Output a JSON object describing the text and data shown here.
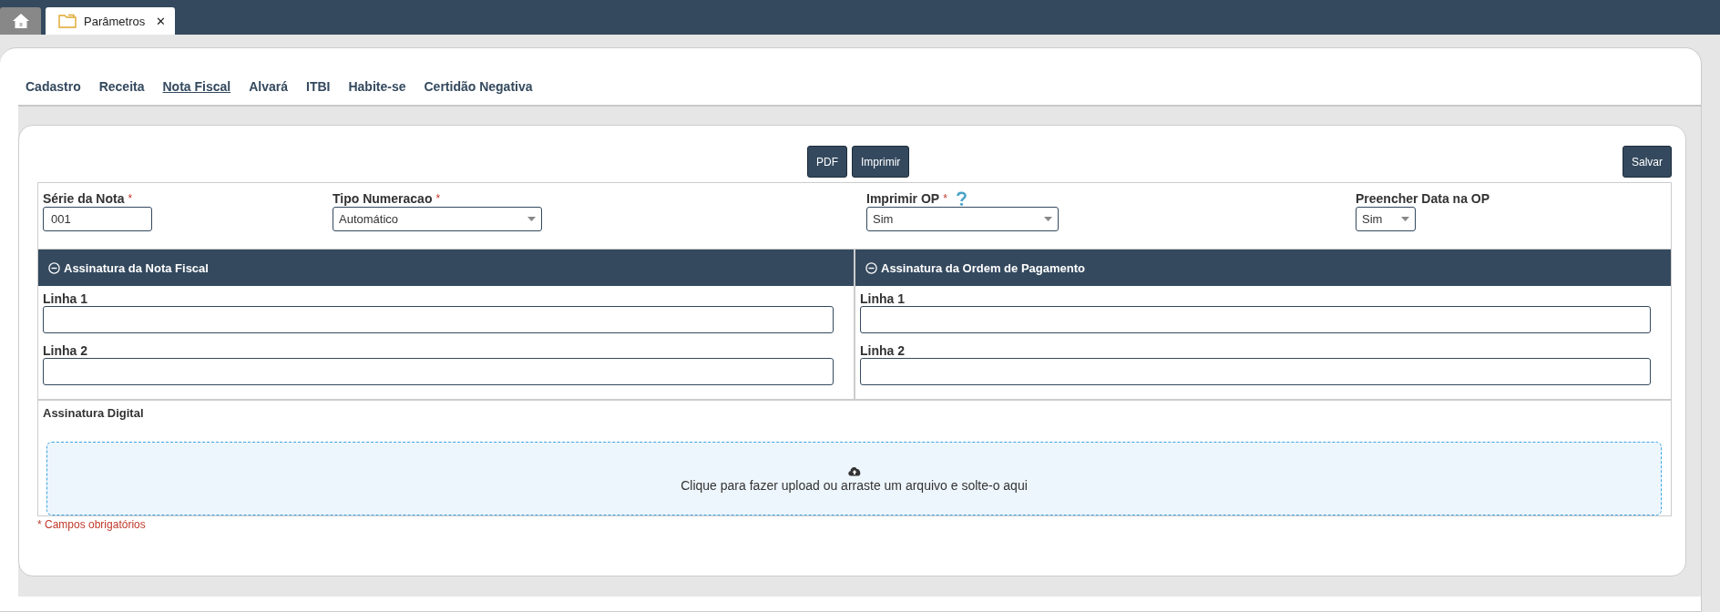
{
  "window_tabs": [
    {
      "kind": "home",
      "selected": false
    },
    {
      "kind": "page",
      "label": "Parâmetros",
      "close": "✕",
      "selected": true
    }
  ],
  "sub_tabs": [
    {
      "label": "Cadastro",
      "selected": false
    },
    {
      "label": "Receita",
      "selected": false
    },
    {
      "label": "Nota Fiscal",
      "selected": true
    },
    {
      "label": "Alvará",
      "selected": false
    },
    {
      "label": "ITBI",
      "selected": false
    },
    {
      "label": "Habite-se",
      "selected": false
    },
    {
      "label": "Certidão Negativa",
      "selected": false
    }
  ],
  "toolbar": {
    "buttons": [
      "PDF",
      "Imprimir"
    ],
    "save": "Salvar"
  },
  "fields": [
    {
      "kind": "text",
      "label": "Série da Nota",
      "required_mark": "*",
      "help": false,
      "value": "001"
    },
    {
      "kind": "select",
      "label": "Tipo Numeracao",
      "required_mark": "*",
      "help": false,
      "value": "Automático"
    },
    {
      "kind": "select",
      "label": "Imprimir OP",
      "required_mark": "*",
      "help": true,
      "value": "Sim"
    },
    {
      "kind": "select",
      "label": "Preencher Data na OP",
      "help": false,
      "value": "Sim"
    }
  ],
  "panels": [
    {
      "title": "Assinatura da Nota Fiscal",
      "expanded": true,
      "lines": [
        {
          "label": "Linha 1"
        },
        {
          "label": "Linha 2"
        }
      ]
    },
    {
      "title": "Assinatura da Ordem de Pagamento",
      "expanded": true,
      "lines": [
        {
          "label": "Linha 1"
        },
        {
          "label": "Linha 2"
        }
      ]
    }
  ],
  "digital_signature": {
    "label": "Assinatura Digital",
    "dropzone_text": "Clique para fazer upload ou arraste um arquivo e solte-o aqui"
  },
  "required_note": "* Campos obrigatórios"
}
